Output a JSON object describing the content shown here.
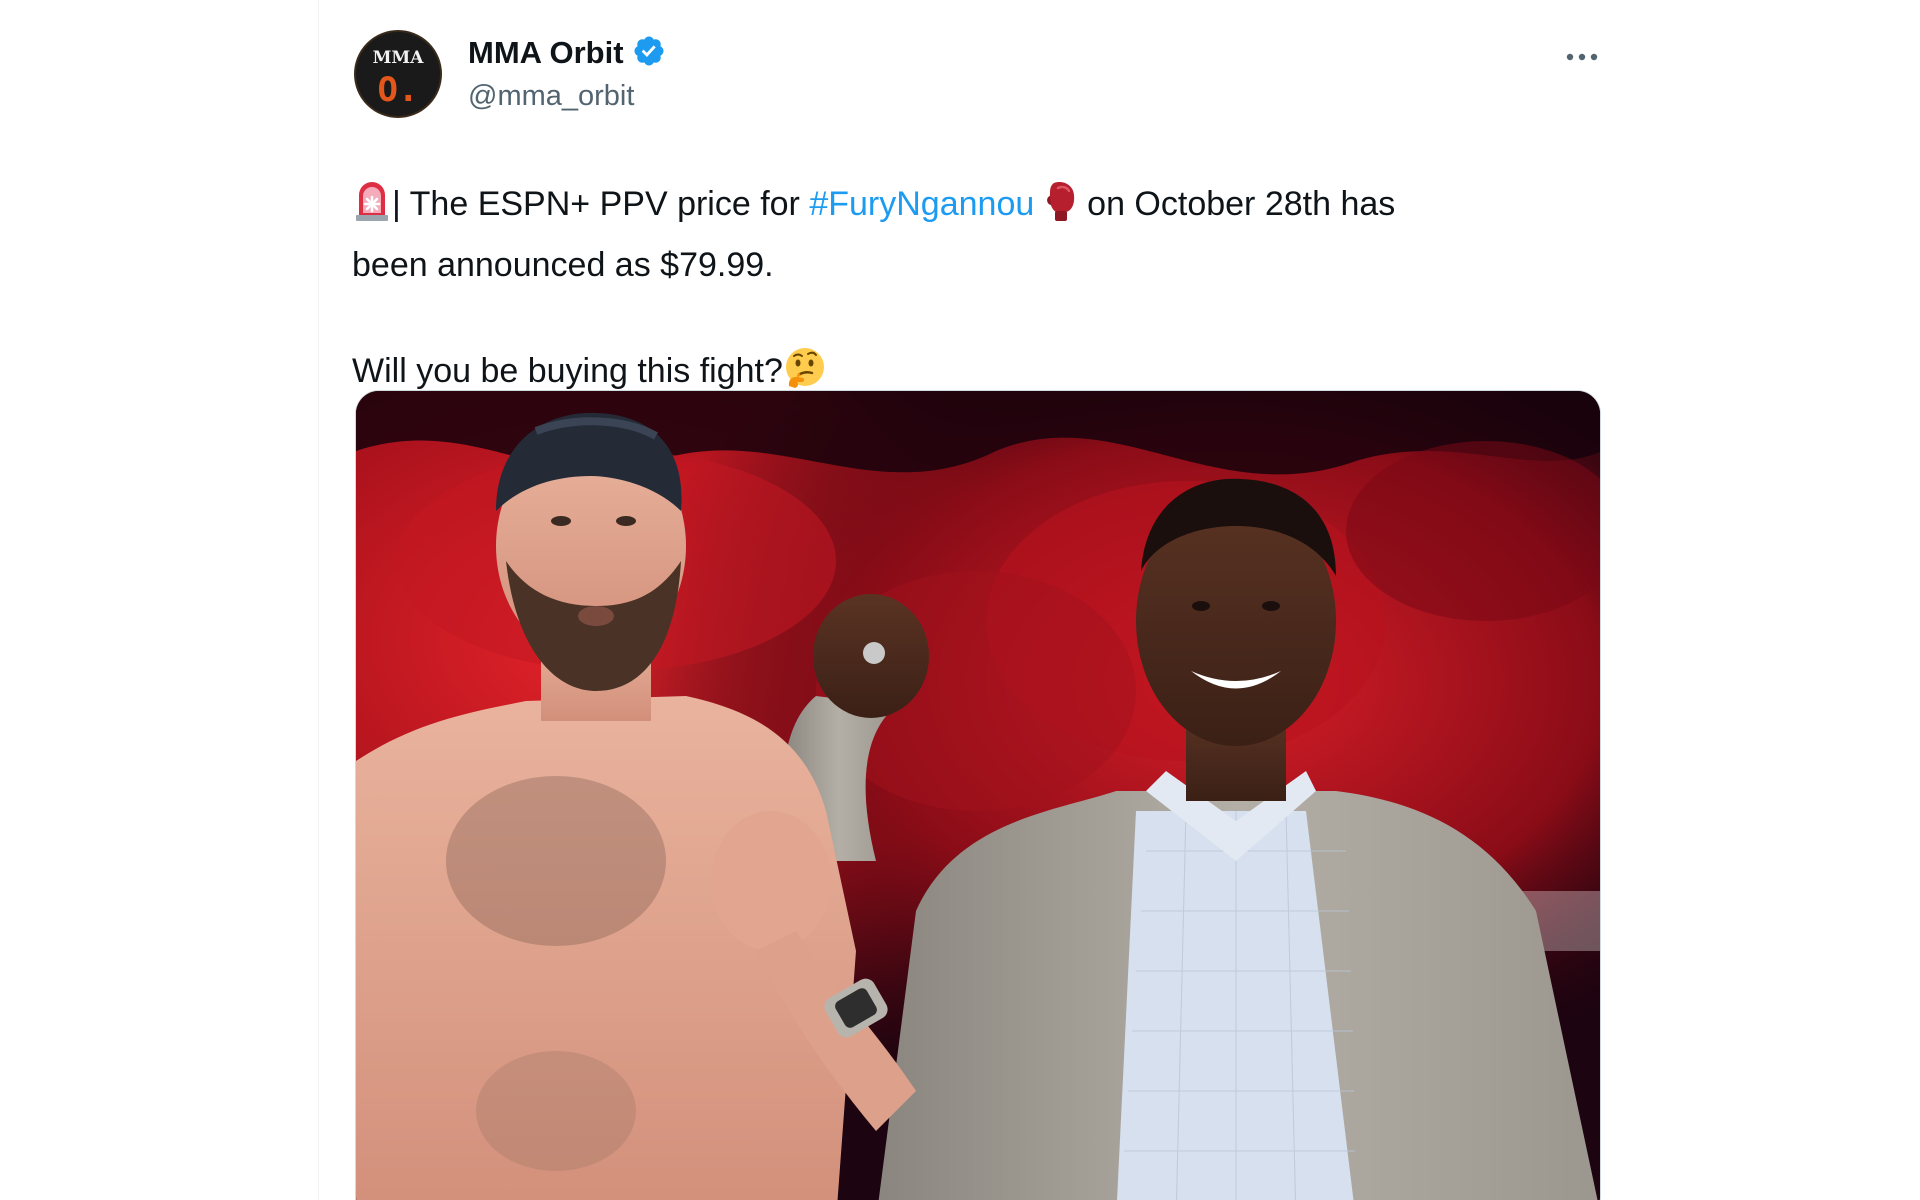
{
  "account": {
    "display_name": "MMA Orbit",
    "handle": "@mma_orbit",
    "verified": true,
    "avatar_text_top": "MMA",
    "avatar_text_bottom": "O."
  },
  "post": {
    "icons": [
      "rotating-light-icon",
      "boxing-glove-icon",
      "thinking-face-icon"
    ],
    "line1_before_hashtag": "| The ESPN+ PPV price for ",
    "hashtag": "#FuryNgannou",
    "line1_after_hashtag": " on October 28th has",
    "line2": "been announced as $79.99.",
    "line3": "Will you be buying this fight?"
  },
  "menu": {
    "more_icon": "more-horizontal-icon"
  },
  "colors": {
    "text": "#0f1419",
    "secondary_text": "#536471",
    "link": "#1d9bf0",
    "verified": "#1d9bf0"
  }
}
